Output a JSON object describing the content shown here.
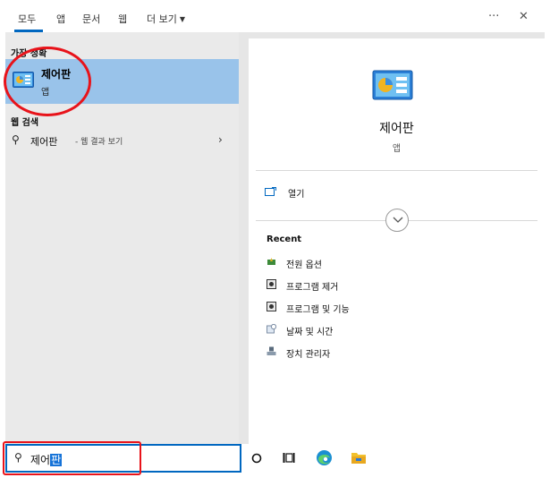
{
  "tabs": [
    {
      "label": "모두",
      "active": true
    },
    {
      "label": "앱"
    },
    {
      "label": "문서"
    },
    {
      "label": "웹"
    },
    {
      "label": "더 보기"
    }
  ],
  "window_buttons": {
    "more": "···",
    "close": "✕"
  },
  "left_pane": {
    "best_match_header": "가장 정확",
    "best_match": {
      "title": "제어판",
      "subtitle": "앱",
      "icon": "control-panel-icon"
    },
    "web_header": "웹 검색",
    "web_result": {
      "term": "제어판",
      "rest": "- 웹 결과 보기",
      "chevron": "›"
    }
  },
  "preview": {
    "title": "제어판",
    "subtitle": "앱",
    "open_label": "열기",
    "recent_header": "Recent",
    "recent_items": [
      {
        "label": "전원 옵션",
        "icon": "power-options-icon"
      },
      {
        "label": "프로그램 제거",
        "icon": "program-icon"
      },
      {
        "label": "프로그램 및 기능",
        "icon": "program-icon"
      },
      {
        "label": "날짜 및 시간",
        "icon": "date-time-icon"
      },
      {
        "label": "장치 관리자",
        "icon": "device-manager-icon"
      }
    ]
  },
  "search": {
    "typed": "제어",
    "selected": "판"
  },
  "taskbar_icons": [
    "cortana-icon",
    "task-view-icon",
    "edge-icon",
    "file-explorer-icon"
  ],
  "colors": {
    "accent": "#0067c0",
    "selection": "#99c3ea",
    "annotation": "#e8131a"
  }
}
